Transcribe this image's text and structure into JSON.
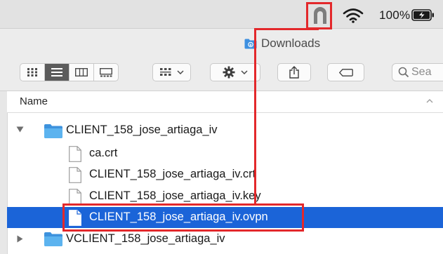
{
  "menubar": {
    "battery_percent": "100%",
    "icons": [
      "vpn-tunnel-icon",
      "wifi-icon",
      "battery-charging-icon"
    ]
  },
  "window": {
    "title": "Downloads",
    "title_icon": "folder-icon"
  },
  "toolbar": {
    "view_buttons": [
      "icon-view-icon",
      "list-view-icon",
      "column-view-icon",
      "gallery-view-icon"
    ],
    "active_view": "list-view-icon",
    "group_icon": "group-icon",
    "action_icon": "gear-icon",
    "share_icon": "share-icon",
    "tag_icon": "tag-icon",
    "search_placeholder": "Sea"
  },
  "list": {
    "column_header": "Name",
    "items": [
      {
        "label": "CLIENT_158_jose_artiaga_iv",
        "type": "folder",
        "expanded": true,
        "level": 0
      },
      {
        "label": "ca.crt",
        "type": "file",
        "level": 1
      },
      {
        "label": "CLIENT_158_jose_artiaga_iv.crt",
        "type": "file",
        "level": 1
      },
      {
        "label": "CLIENT_158_jose_artiaga_iv.key",
        "type": "file",
        "level": 1
      },
      {
        "label": "CLIENT_158_jose_artiaga_iv.ovpn",
        "type": "file",
        "level": 1,
        "selected": true
      },
      {
        "label": "VCLIENT_158_jose_artiaga_iv",
        "type": "folder",
        "expanded": false,
        "level": 0
      }
    ]
  },
  "colors": {
    "selection": "#1b64d8",
    "annotation": "#e3282b",
    "folder": "#4aa5e8"
  }
}
